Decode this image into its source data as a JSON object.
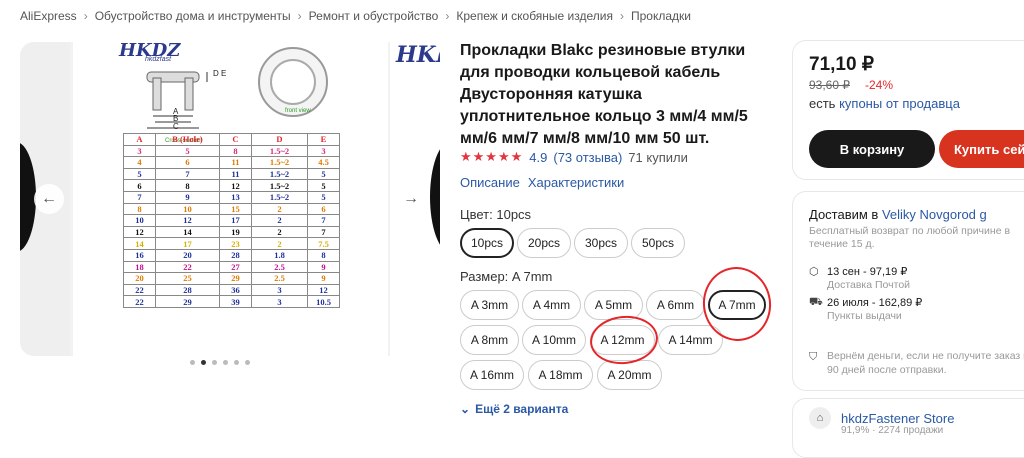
{
  "breadcrumb": [
    "AliExpress",
    "Обустройство дома и инструменты",
    "Ремонт и обустройство",
    "Крепеж и скобяные изделия",
    "Прокладки"
  ],
  "gallery": {
    "logo": "HKDZ",
    "logo_sub": "hkdzfast",
    "right_logo": "HKI",
    "dim_labels": [
      "D",
      "E",
      "A",
      "B",
      "C"
    ],
    "captions": [
      "Cross-section",
      "front view"
    ],
    "table_header": [
      "A",
      "B (Hole)",
      "C",
      "D",
      "E"
    ],
    "table_rows": [
      [
        "3",
        "5",
        "8",
        "1.5~2",
        "3"
      ],
      [
        "4",
        "6",
        "11",
        "1.5~2",
        "4.5"
      ],
      [
        "5",
        "7",
        "11",
        "1.5~2",
        "5"
      ],
      [
        "6",
        "8",
        "12",
        "1.5~2",
        "5"
      ],
      [
        "7",
        "9",
        "13",
        "1.5~2",
        "5"
      ],
      [
        "8",
        "10",
        "15",
        "2",
        "6"
      ],
      [
        "10",
        "12",
        "17",
        "2",
        "7"
      ],
      [
        "12",
        "14",
        "19",
        "2",
        "7"
      ],
      [
        "14",
        "17",
        "23",
        "2",
        "7.5"
      ],
      [
        "16",
        "20",
        "28",
        "1.8",
        "8"
      ],
      [
        "18",
        "22",
        "27",
        "2.5",
        "9"
      ],
      [
        "20",
        "25",
        "29",
        "2.5",
        "9"
      ],
      [
        "22",
        "28",
        "36",
        "3",
        "12"
      ],
      [
        "22",
        "29",
        "39",
        "3",
        "10.5"
      ]
    ],
    "arrow_left": "←",
    "arrow_right": "→"
  },
  "product": {
    "title": "Прокладки Blakc резиновые втулки для проводки кольцевой кабель Двусторонняя катушка уплотнительное кольцо 3 мм/4 мм/5 мм/6 мм/7 мм/8 мм/10 мм 50 шт.",
    "stars": "★★★★★",
    "rating": "4.9",
    "reviews": "(73 отзыва)",
    "sold": "71 купили",
    "tabs": [
      "Описание",
      "Характеристики"
    ],
    "color_label": "Цвет: 10pcs",
    "colors": [
      "10pcs",
      "20pcs",
      "30pcs",
      "50pcs"
    ],
    "size_label": "Размер: A 7mm",
    "sizes": [
      "A 3mm",
      "A 4mm",
      "A 5mm",
      "A 6mm",
      "A 7mm",
      "A 8mm",
      "A 10mm",
      "A 12mm",
      "A 14mm",
      "A 16mm",
      "A 18mm",
      "A 20mm"
    ],
    "more": "Ещё 2 варианта"
  },
  "buy": {
    "price": "71,10 ₽",
    "old_price": "93,60 ₽",
    "discount": "-24%",
    "coupon_prefix": "есть ",
    "coupon_link": "купоны от продавца",
    "cart": "В корзину",
    "buy_now": "Купить сейчас"
  },
  "delivery": {
    "prefix": "Доставим в ",
    "city": "Veliky Novgorod g",
    "return_note": "Бесплатный возврат по любой причине в течение 15 д.",
    "option1": "13 сен - 97,19 ₽",
    "option1_sub": "Доставка Почтой",
    "option2": "26 июля - 162,89 ₽",
    "option2_sub": "Пункты выдачи",
    "refund": "Вернём деньги, если не получите заказ в течение\n90 дней после отправки."
  },
  "store": {
    "name": "hkdzFastener Store",
    "sub": "91,9% · 2274 продажи"
  },
  "colors": {
    "accent": "#e4262a",
    "link": "#2a59a5",
    "cart_bg": "#191919",
    "buy_bg": "#d8331f"
  }
}
